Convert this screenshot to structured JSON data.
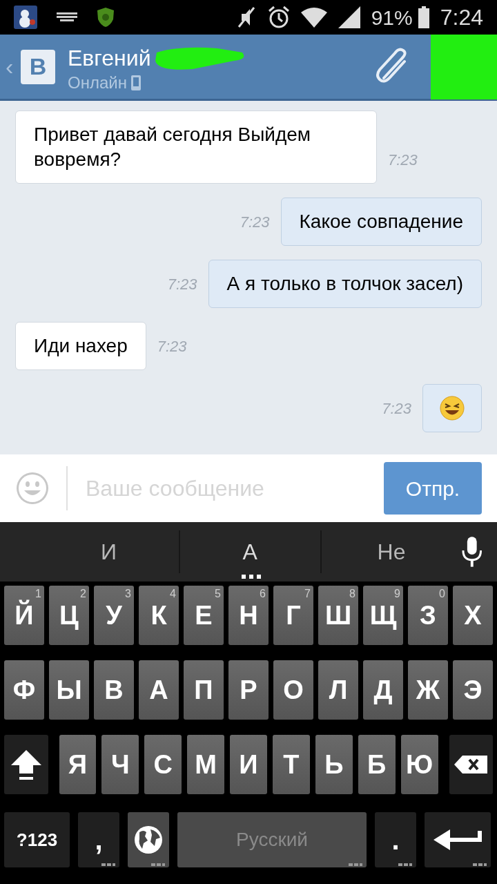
{
  "status_bar": {
    "battery": "91%",
    "time": "7:24"
  },
  "header": {
    "back": "‹",
    "logo": "B",
    "name": "Евгений",
    "status": "Онлайн"
  },
  "messages": [
    {
      "kind": "incoming",
      "text": "Привет давай сегодня Выйдем вовремя?",
      "time": "7:23"
    },
    {
      "kind": "outgoing",
      "text": "Какое совпадение",
      "time": "7:23"
    },
    {
      "kind": "outgoing",
      "text": "А я только в толчок засел)",
      "time": "7:23"
    },
    {
      "kind": "incoming",
      "text": "Иди нахер",
      "time": "7:23"
    },
    {
      "kind": "emoji",
      "time": "7:23"
    }
  ],
  "composer": {
    "placeholder": "Ваше сообщение",
    "send": "Отпр."
  },
  "keyboard": {
    "suggestions": [
      {
        "text": "И",
        "selected": false
      },
      {
        "text": "А",
        "selected": true
      },
      {
        "text": "Не",
        "selected": false
      }
    ],
    "rows": [
      [
        {
          "kind": "letter",
          "label": "Й",
          "hint": "1"
        },
        {
          "kind": "letter",
          "label": "Ц",
          "hint": "2"
        },
        {
          "kind": "letter",
          "label": "У",
          "hint": "3"
        },
        {
          "kind": "letter",
          "label": "К",
          "hint": "4"
        },
        {
          "kind": "letter",
          "label": "Е",
          "hint": "5"
        },
        {
          "kind": "letter",
          "label": "Н",
          "hint": "6"
        },
        {
          "kind": "letter",
          "label": "Г",
          "hint": "7"
        },
        {
          "kind": "letter",
          "label": "Ш",
          "hint": "8"
        },
        {
          "kind": "letter",
          "label": "Щ",
          "hint": "9"
        },
        {
          "kind": "letter",
          "label": "З",
          "hint": "0"
        },
        {
          "kind": "letter",
          "label": "Х"
        }
      ],
      [
        {
          "kind": "letter",
          "label": "Ф"
        },
        {
          "kind": "letter",
          "label": "Ы"
        },
        {
          "kind": "letter",
          "label": "В"
        },
        {
          "kind": "letter",
          "label": "А"
        },
        {
          "kind": "letter",
          "label": "П"
        },
        {
          "kind": "letter",
          "label": "Р"
        },
        {
          "kind": "letter",
          "label": "О"
        },
        {
          "kind": "letter",
          "label": "Л"
        },
        {
          "kind": "letter",
          "label": "Д"
        },
        {
          "kind": "letter",
          "label": "Ж"
        },
        {
          "kind": "letter",
          "label": "Э"
        }
      ],
      [
        {
          "kind": "shift"
        },
        {
          "kind": "letter",
          "label": "Я"
        },
        {
          "kind": "letter",
          "label": "Ч"
        },
        {
          "kind": "letter",
          "label": "С"
        },
        {
          "kind": "letter",
          "label": "М"
        },
        {
          "kind": "letter",
          "label": "И"
        },
        {
          "kind": "letter",
          "label": "Т"
        },
        {
          "kind": "letter",
          "label": "Ь"
        },
        {
          "kind": "letter",
          "label": "Б"
        },
        {
          "kind": "letter",
          "label": "Ю"
        },
        {
          "kind": "backspace"
        }
      ]
    ],
    "bottom_row": [
      {
        "kind": "symbols",
        "label": "?123"
      },
      {
        "kind": "punct",
        "label": ","
      },
      {
        "kind": "globe"
      },
      {
        "kind": "space",
        "label": "Русский"
      },
      {
        "kind": "punct",
        "label": "."
      },
      {
        "kind": "enter"
      }
    ]
  }
}
